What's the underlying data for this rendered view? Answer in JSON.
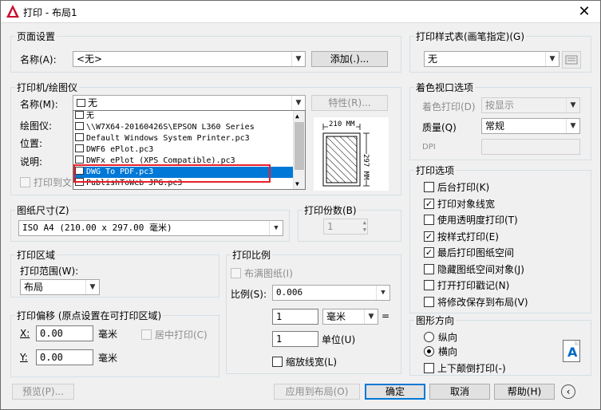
{
  "window": {
    "title": "打印 - 布局1"
  },
  "page_setup": {
    "title": "页面设置",
    "name_label": "名称(A):",
    "name_value": "<无>",
    "add_button": "添加(.)..."
  },
  "plotter": {
    "title": "打印机/绘图仪",
    "name_label": "名称(M):",
    "name_value": "无",
    "properties_button": "特性(R)...",
    "plotter_label": "绘图仪:",
    "location_label": "位置:",
    "description_label": "说明:",
    "print_to_file": "打印到文",
    "dropdown_items": [
      "无",
      "\\\\W7X64-20160426S\\EPSON L360 Series",
      "Default Windows System Printer.pc3",
      "DWF6 ePlot.pc3",
      "DWFx ePlot (XPS Compatible).pc3",
      "DWG To PDF.pc3",
      "PublishToWeb JPG.pc3"
    ],
    "preview_width": "210 MM",
    "preview_height": "297 MM"
  },
  "paper_size": {
    "title": "图纸尺寸(Z)",
    "value": "ISO A4 (210.00 x 297.00 毫米)"
  },
  "copies": {
    "title": "打印份数(B)",
    "value": "1"
  },
  "plot_area": {
    "title": "打印区域",
    "range_label": "打印范围(W):",
    "range_value": "布局"
  },
  "plot_scale": {
    "title": "打印比例",
    "fit_paper": "布满图纸(I)",
    "scale_label": "比例(S):",
    "scale_value": "0.006",
    "value1": "1",
    "unit_value": "毫米",
    "equals": "=",
    "value2": "1",
    "unit_label": "单位(U)",
    "scale_lineweights": "缩放线宽(L)"
  },
  "plot_offset": {
    "title": "打印偏移 (原点设置在可打印区域)",
    "x_label": "X:",
    "x_value": "0.00",
    "x_unit": "毫米",
    "center_plot": "居中打印(C)",
    "y_label": "Y:",
    "y_value": "0.00",
    "y_unit": "毫米"
  },
  "plot_style_table": {
    "title": "打印样式表(画笔指定)(G)",
    "value": "无"
  },
  "shaded_viewport": {
    "title": "着色视口选项",
    "shade_plot_label": "着色打印(D)",
    "shade_plot_value": "按显示",
    "quality_label": "质量(Q)",
    "quality_value": "常规",
    "dpi_label": "DPI"
  },
  "plot_options": {
    "title": "打印选项",
    "items": [
      {
        "label": "后台打印(K)",
        "checked": false
      },
      {
        "label": "打印对象线宽",
        "checked": true
      },
      {
        "label": "使用透明度打印(T)",
        "checked": false
      },
      {
        "label": "按样式打印(E)",
        "checked": true
      },
      {
        "label": "最后打印图纸空间",
        "checked": true
      },
      {
        "label": "隐藏图纸空间对象(J)",
        "checked": false
      },
      {
        "label": "打开打印戳记(N)",
        "checked": false
      },
      {
        "label": "将修改保存到布局(V)",
        "checked": false
      }
    ]
  },
  "orientation": {
    "title": "图形方向",
    "portrait": "纵向",
    "landscape": "横向",
    "upside_down": "上下颠倒打印(-)",
    "selected": "landscape",
    "icon_letter": "A"
  },
  "footer": {
    "preview_button": "预览(P)...",
    "apply_button": "应用到布局(O)",
    "ok_button": "确定",
    "cancel_button": "取消",
    "help_button": "帮助(H)"
  },
  "colors": {
    "accent": "#0078d7",
    "highlight_box": "#e8202a"
  }
}
